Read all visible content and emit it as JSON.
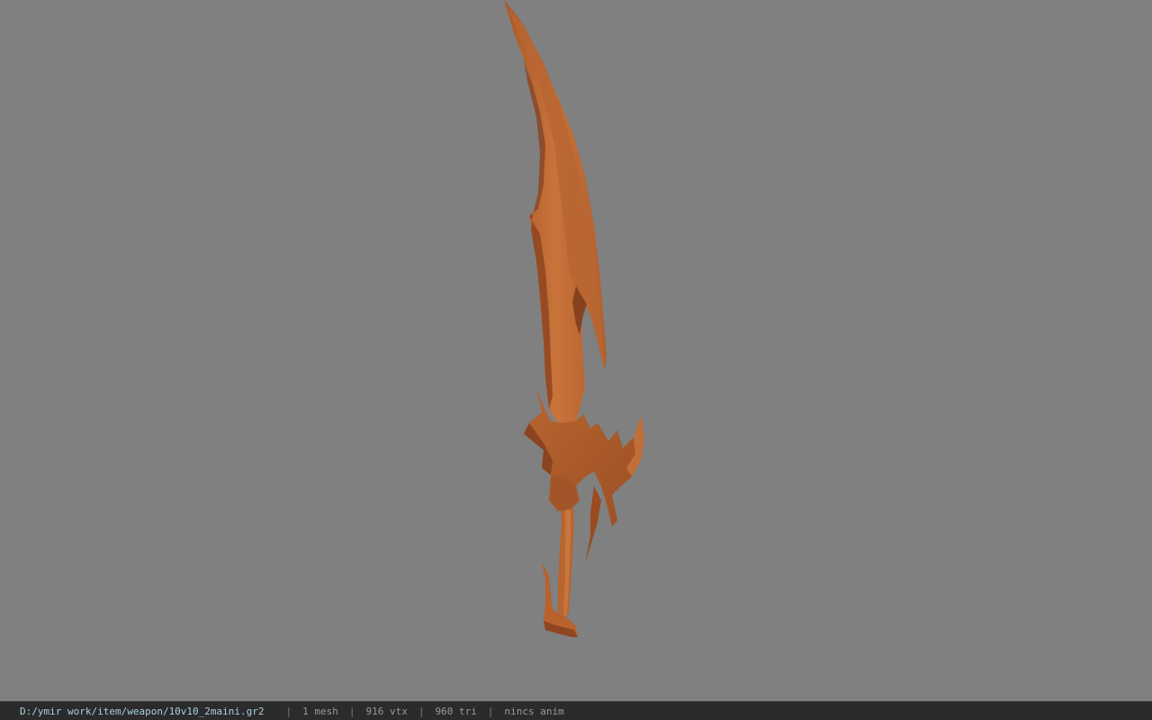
{
  "viewer": {
    "background_color": "#808080",
    "model_color": "#c06a35",
    "model": "curved-sword-model"
  },
  "status": {
    "path": "D:/ymir work/item/weapon/10v10_2maini.gr2",
    "separator": "|",
    "mesh": "1 mesh",
    "vtx": "916 vtx",
    "tri": "960 tri",
    "anim": "nincs anim"
  }
}
